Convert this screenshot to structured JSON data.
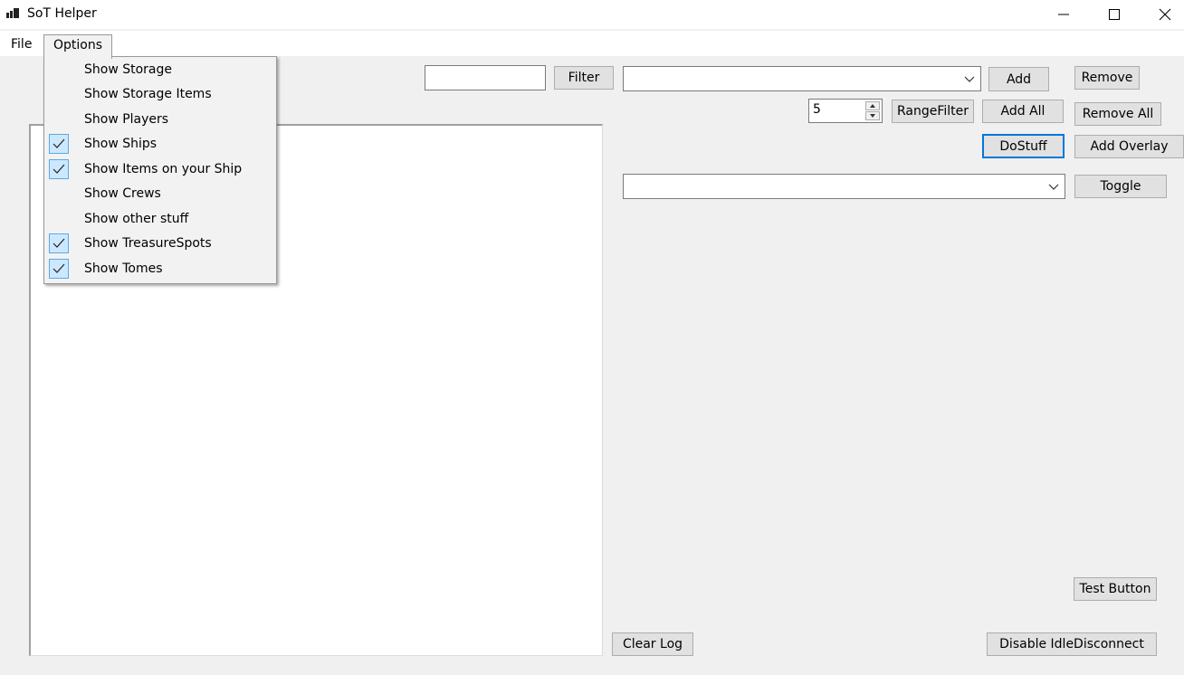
{
  "window": {
    "title": "SoT Helper"
  },
  "menu": {
    "file": "File",
    "options": "Options",
    "options_items": [
      {
        "label": "Show Storage",
        "checked": false
      },
      {
        "label": "Show Storage Items",
        "checked": false
      },
      {
        "label": "Show Players",
        "checked": false
      },
      {
        "label": "Show Ships",
        "checked": true
      },
      {
        "label": "Show Items on your Ship",
        "checked": true
      },
      {
        "label": "Show Crews",
        "checked": false
      },
      {
        "label": "Show other stuff",
        "checked": false
      },
      {
        "label": "Show TreasureSpots",
        "checked": true
      },
      {
        "label": "Show Tomes",
        "checked": true
      }
    ]
  },
  "controls": {
    "filter_value": "",
    "filter_button": "Filter",
    "add_combo_value": "",
    "add_button": "Add",
    "remove_button": "Remove",
    "range_value": "5",
    "range_filter_button": "RangeFilter",
    "add_all_button": "Add All",
    "remove_all_button": "Remove All",
    "dostuff_button": "DoStuff",
    "add_overlay_button": "Add Overlay",
    "toggle_combo_value": "",
    "toggle_button": "Toggle",
    "test_button": "Test Button",
    "clear_log_button": "Clear Log",
    "disable_idle_button": "Disable IdleDisconnect"
  },
  "log": {
    "text": ""
  }
}
